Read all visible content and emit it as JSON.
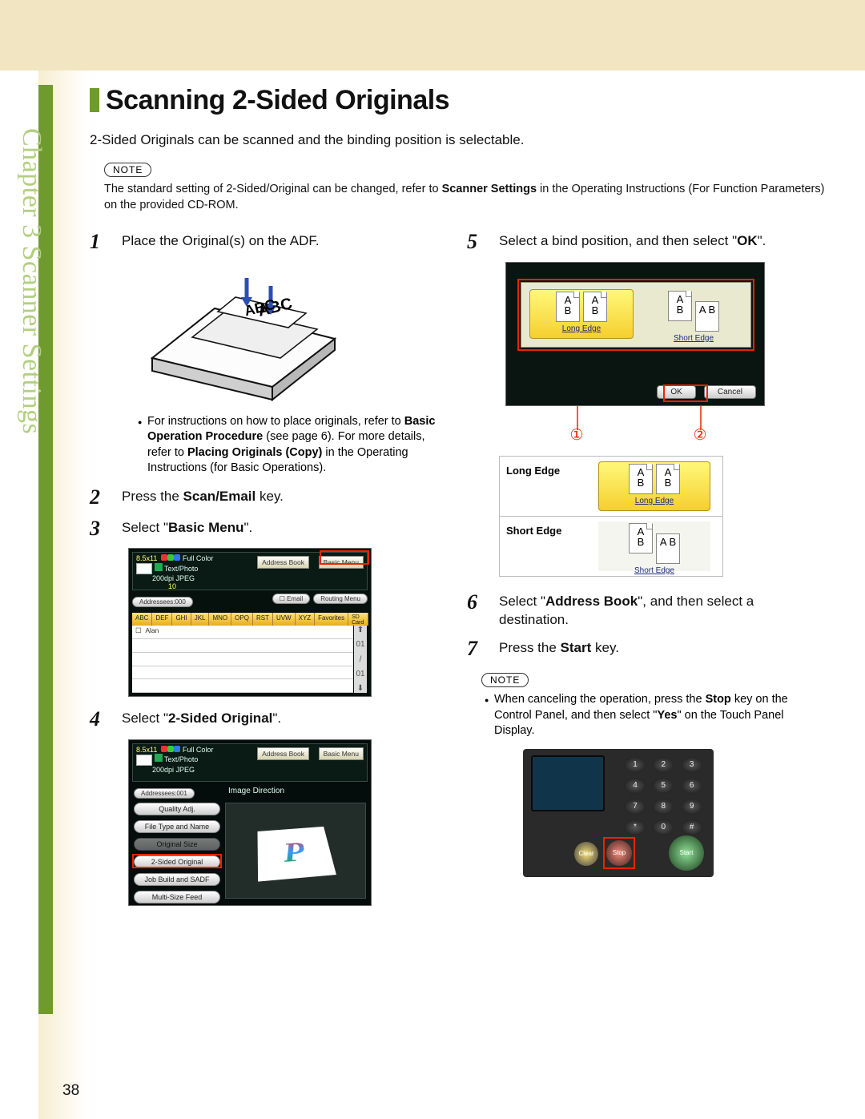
{
  "side_label": "Chapter 3    Scanner Settings",
  "title": "Scanning 2-Sided Originals",
  "intro": "2-Sided Originals can be scanned and the binding position is selectable.",
  "note_label": "NOTE",
  "top_note_a": "The standard setting of 2-Sided/Original can be changed, refer to ",
  "top_note_b": "Scanner Settings",
  "top_note_c": " in the Operating Instructions (For Function Parameters) on the provided CD-ROM.",
  "step1_num": "1",
  "step1_text": "Place the Original(s) on the ADF.",
  "adf_paper_text": "ABC",
  "step1_note_a": "For instructions on how to place originals, refer to ",
  "step1_note_b": "Basic Operation Procedure",
  "step1_note_c": " (see page 6). For more details, refer to ",
  "step1_note_d": "Placing Originals (Copy)",
  "step1_note_e": " in the Operating Instructions (for Basic Operations).",
  "step2_num": "2",
  "step2_a": "Press the ",
  "step2_b": "Scan/Email",
  "step2_c": " key.",
  "step3_num": "3",
  "step3_a": "Select \"",
  "step3_b": "Basic Menu",
  "step3_c": "\".",
  "screen3": {
    "top1": "8.5x11",
    "top2": "Full Color",
    "top3": "Text/Photo",
    "top4": "200dpi JPEG",
    "top5": "10",
    "addr_book": "Address Book",
    "basic_menu": "Basic Menu",
    "addresses": "Addressees:000",
    "email": "Email",
    "routing": "Routing Menu",
    "tabs": [
      "ABC",
      "DEF",
      "GHI",
      "JKL",
      "MNO",
      "OPQ",
      "RST",
      "UVW",
      "XYZ",
      "Favorites",
      "SD Card / Hard Drive"
    ],
    "row1": "Alan",
    "scroll": [
      "⬆",
      "01",
      "/",
      "01",
      "⬇"
    ]
  },
  "step4_num": "4",
  "step4_a": "Select \"",
  "step4_b": "2-Sided Original",
  "step4_c": "\".",
  "screen4": {
    "top1": "8.5x11",
    "top2": "Full Color",
    "top3": "Text/Photo",
    "top4": "200dpi JPEG",
    "addr_book": "Address Book",
    "basic_menu": "Basic Menu",
    "addresses": "Addressees:001",
    "img_dir": "Image Direction",
    "buttons": [
      "Quality Adj.",
      "File Type and Name",
      "Original Size",
      "2-Sided Original",
      "Job Build and SADF",
      "Multi-Size Feed"
    ],
    "preview_letter": "P"
  },
  "step5_num": "5",
  "step5_a": "Select a bind position, and then select \"",
  "step5_b": "OK",
  "step5_c": "\".",
  "screen5": {
    "long_edge": "Long Edge",
    "short_edge": "Short Edge",
    "ok": "OK",
    "cancel": "Cancel",
    "ab": "A\nB"
  },
  "circ1": "①",
  "circ2": "②",
  "table": {
    "row1_label": "Long Edge",
    "row1_cap": "Long Edge",
    "row2_label": "Short Edge",
    "row2_cap": "Short Edge"
  },
  "step6_num": "6",
  "step6_a": "Select \"",
  "step6_b": "Address Book",
  "step6_c": "\", and then select a destination.",
  "step7_num": "7",
  "step7_a": "Press the ",
  "step7_b": "Start",
  "step7_c": " key.",
  "bottom_note_a": "When canceling the operation, press the ",
  "bottom_note_b": "Stop",
  "bottom_note_c": " key on the Control Panel, and then select \"",
  "bottom_note_d": "Yes",
  "bottom_note_e": "\" on the Touch Panel Display.",
  "panel": {
    "keys": [
      "1",
      "2",
      "3",
      "4",
      "5",
      "6",
      "7",
      "8",
      "9",
      "*",
      "0",
      "#"
    ],
    "clear": "Clear",
    "stop": "Stop",
    "start": "Start"
  },
  "page_number": "38"
}
